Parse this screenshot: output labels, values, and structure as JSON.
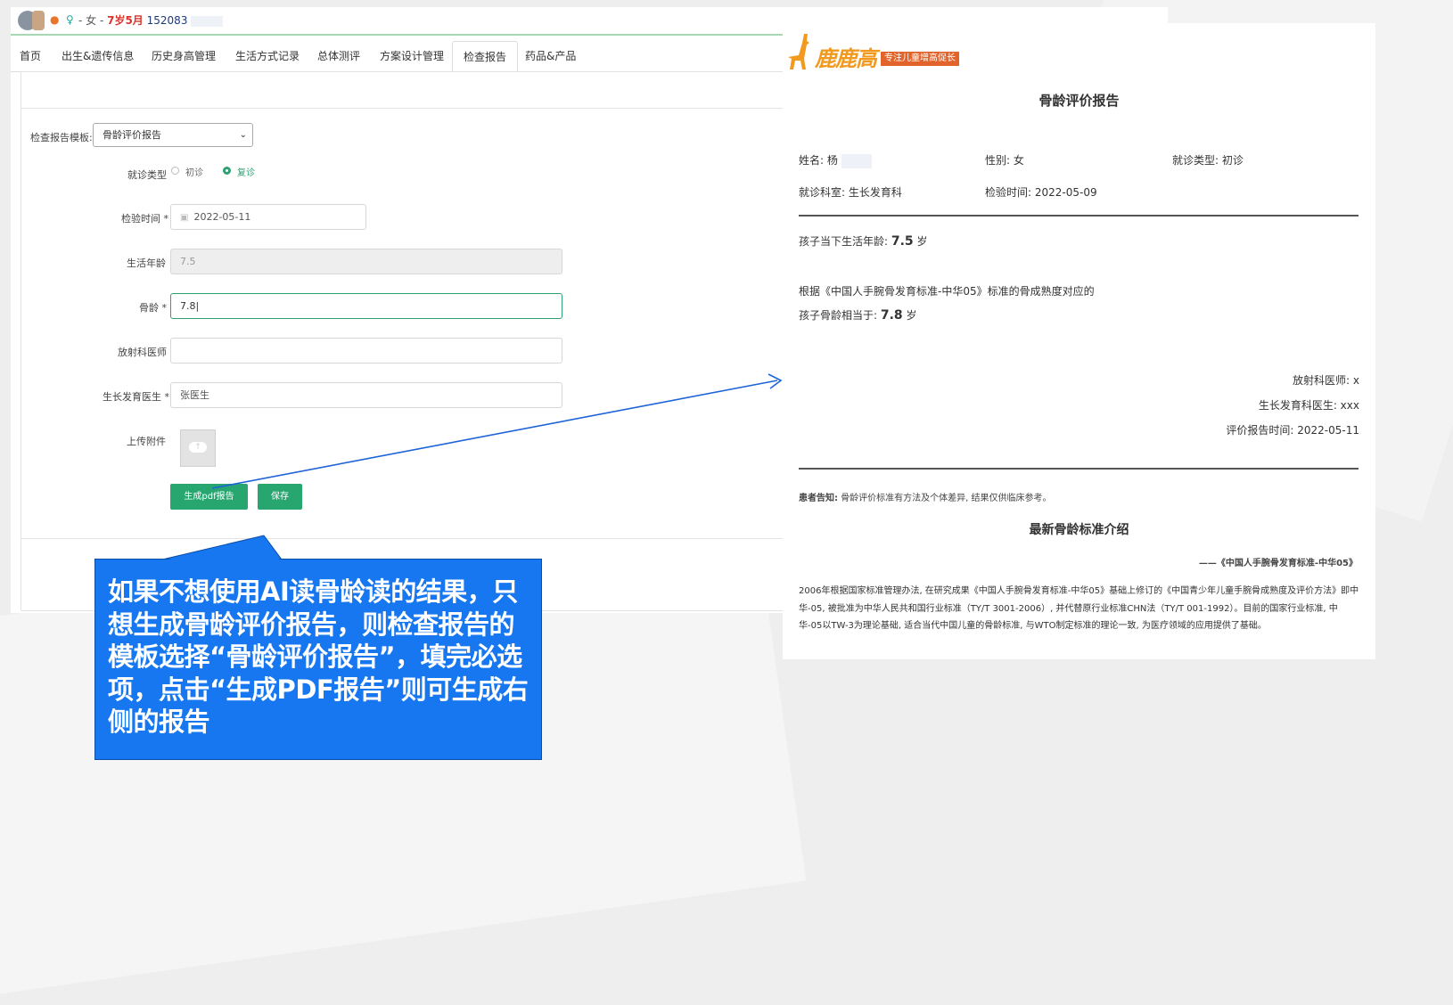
{
  "header": {
    "patient_info": "- 女 - ",
    "age": "7岁5月",
    "record_no": "152083"
  },
  "tabs": [
    {
      "label": "首页"
    },
    {
      "label": "出生&遗传信息"
    },
    {
      "label": "历史身高管理"
    },
    {
      "label": "生活方式记录"
    },
    {
      "label": "总体测评"
    },
    {
      "label": "方案设计管理"
    },
    {
      "label": "检查报告",
      "active": true
    },
    {
      "label": "药品&产品"
    }
  ],
  "form": {
    "template_label": "检查报告模板:",
    "template_value": "骨龄评价报告",
    "visit_type_label": "就诊类型",
    "visit_options": [
      "初诊",
      "复诊"
    ],
    "visit_selected": "复诊",
    "exam_time_label": "检验时间 *",
    "exam_time_value": "2022-05-11",
    "life_age_label": "生活年龄",
    "life_age_value": "7.5",
    "bone_age_label": "骨龄 *",
    "bone_age_value": "7.8",
    "radiologist_label": "放射科医师",
    "radiologist_value": "",
    "growth_doctor_label": "生长发育医生 *",
    "growth_doctor_value": "张医生",
    "upload_label": "上传附件",
    "generate_pdf_label": "生成pdf报告",
    "save_label": "保存"
  },
  "callout": {
    "text": "如果不想使用AI读骨龄读的结果，只想生成骨龄评价报告，则检查报告的模板选择“骨龄评价报告”，填完必选项，点击“生成PDF报告”则可生成右侧的报告"
  },
  "report": {
    "logo_text": "鹿鹿高",
    "logo_tag": "专注儿童增高促长",
    "title": "骨龄评价报告",
    "name": "姓名: 杨",
    "gender": "性别: 女",
    "visit_type": "就诊类型: 初诊",
    "department": "就诊科室: 生长发育科",
    "exam_time": "检验时间: 2022-05-09",
    "life_age_prefix": "孩子当下生活年龄: ",
    "life_age_value": "7.5",
    "life_age_unit": " 岁",
    "standard_line": "根据《中国人手腕骨发育标准-中华05》标准的骨成熟度对应的",
    "bone_age_prefix": "孩子骨龄相当于: ",
    "bone_age_value": "7.8",
    "bone_age_unit": " 岁",
    "radiologist": "放射科医师: x",
    "growth_doctor": "生长发育科医生: xxx",
    "report_time": "评价报告时间: 2022-05-11",
    "notice_label": "患者告知:",
    "notice_text": "骨龄评价标准有方法及个体差异, 结果仅供临床参考。",
    "section_title": "最新骨龄标准介绍",
    "section_subtitle": "——《中国人手腕骨发育标准-中华05》",
    "paragraph": "2006年根据国家标准管理办法, 在研究成果《中国人手腕骨发育标准-中华05》基础上修订的《中国青少年儿童手腕骨成熟度及评价方法》即中华-05, 被批准为中华人民共和国行业标准（TY/T 3001-2006）, 并代替原行业标准CHN法（TY/T 001-1992）。目前的国家行业标准, 中华-05以TW-3为理论基础, 适合当代中国儿童的骨龄标准, 与WTO制定标准的理论一致, 为医疗领域的应用提供了基础。"
  },
  "colors": {
    "accent_green": "#27a76f",
    "callout_blue": "#1677f0",
    "arrow_blue": "#1e63d8",
    "logo_orange": "#f19a1f"
  }
}
